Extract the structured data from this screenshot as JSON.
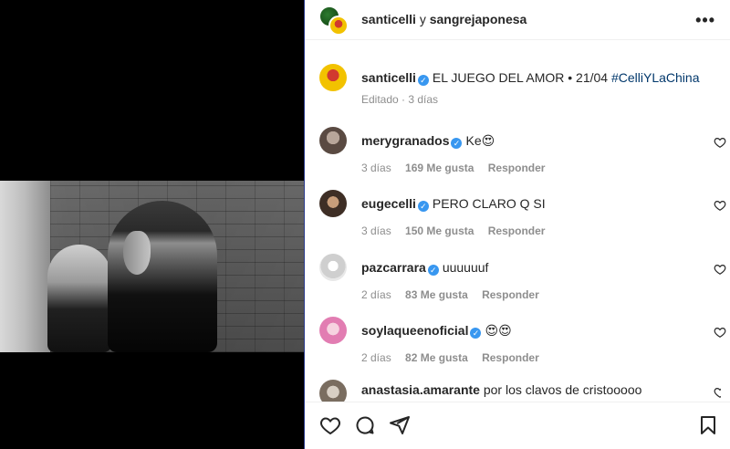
{
  "header": {
    "user1": "santicelli",
    "joiner": "y",
    "user2": "sangrejaponesa",
    "more_icon": "more-horizontal-icon"
  },
  "caption": {
    "username": "santicelli",
    "text": "EL JUEGO DEL AMOR • 21/04",
    "hashtag": "#CelliYLaChina",
    "meta": "Editado · 3 días"
  },
  "comments": [
    {
      "username": "merygranados",
      "text": "Ke😍",
      "time": "3 días",
      "likes": "169 Me gusta",
      "reply": "Responder"
    },
    {
      "username": "eugecelli",
      "text": "PERO CLARO Q SI",
      "time": "3 días",
      "likes": "150 Me gusta",
      "reply": "Responder"
    },
    {
      "username": "pazcarrara",
      "text": "uuuuuuf",
      "time": "2 días",
      "likes": "83 Me gusta",
      "reply": "Responder"
    },
    {
      "username": "soylaqueenoficial",
      "text": "😍😍",
      "time": "2 días",
      "likes": "82 Me gusta",
      "reply": "Responder"
    },
    {
      "username": "anastasia.amarante",
      "text": "por los clavos de cristooooo",
      "time": "",
      "likes": "",
      "reply": ""
    }
  ],
  "footer": {
    "icons": [
      "heart-icon",
      "comment-icon",
      "share-icon",
      "bookmark-icon"
    ]
  },
  "colors": {
    "verified": "#3897f0",
    "hashtag": "#00376b",
    "meta_gray": "#8e8e8e",
    "text": "#262626"
  }
}
